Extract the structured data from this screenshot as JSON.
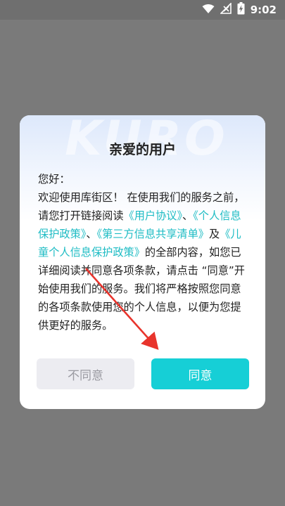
{
  "status_bar": {
    "time": "9:02",
    "icons": [
      "wifi-icon",
      "signal-icon",
      "battery-charging-icon"
    ]
  },
  "dialog": {
    "watermark": "KURO",
    "title": "亲爱的用户",
    "greeting": "您好：",
    "text_1": "欢迎使用库街区！ 在使用我们的服务之前，请您打开链接阅读",
    "link_user_agreement": "《用户协议》",
    "sep_1": "、",
    "link_privacy_policy": "《个人信息保护政策》",
    "sep_2": "、",
    "link_third_party": "《第三方信息共享清单》",
    "text_and": "及",
    "link_children_policy": "《儿童个人信息保护政策》",
    "text_2": "的全部内容，如您已详细阅读并同意各项条款，请点击 “同意”开始使用我们的服务。我们将严格按照您同意的各项条款使用您的个人信息，以便为您提供更好的服务。",
    "disagree_label": "不同意",
    "agree_label": "同意"
  },
  "colors": {
    "link": "#1ebcc4",
    "agree_button": "#16cfd6",
    "disagree_button": "#ececf1",
    "annotation_arrow": "#e8342c"
  }
}
